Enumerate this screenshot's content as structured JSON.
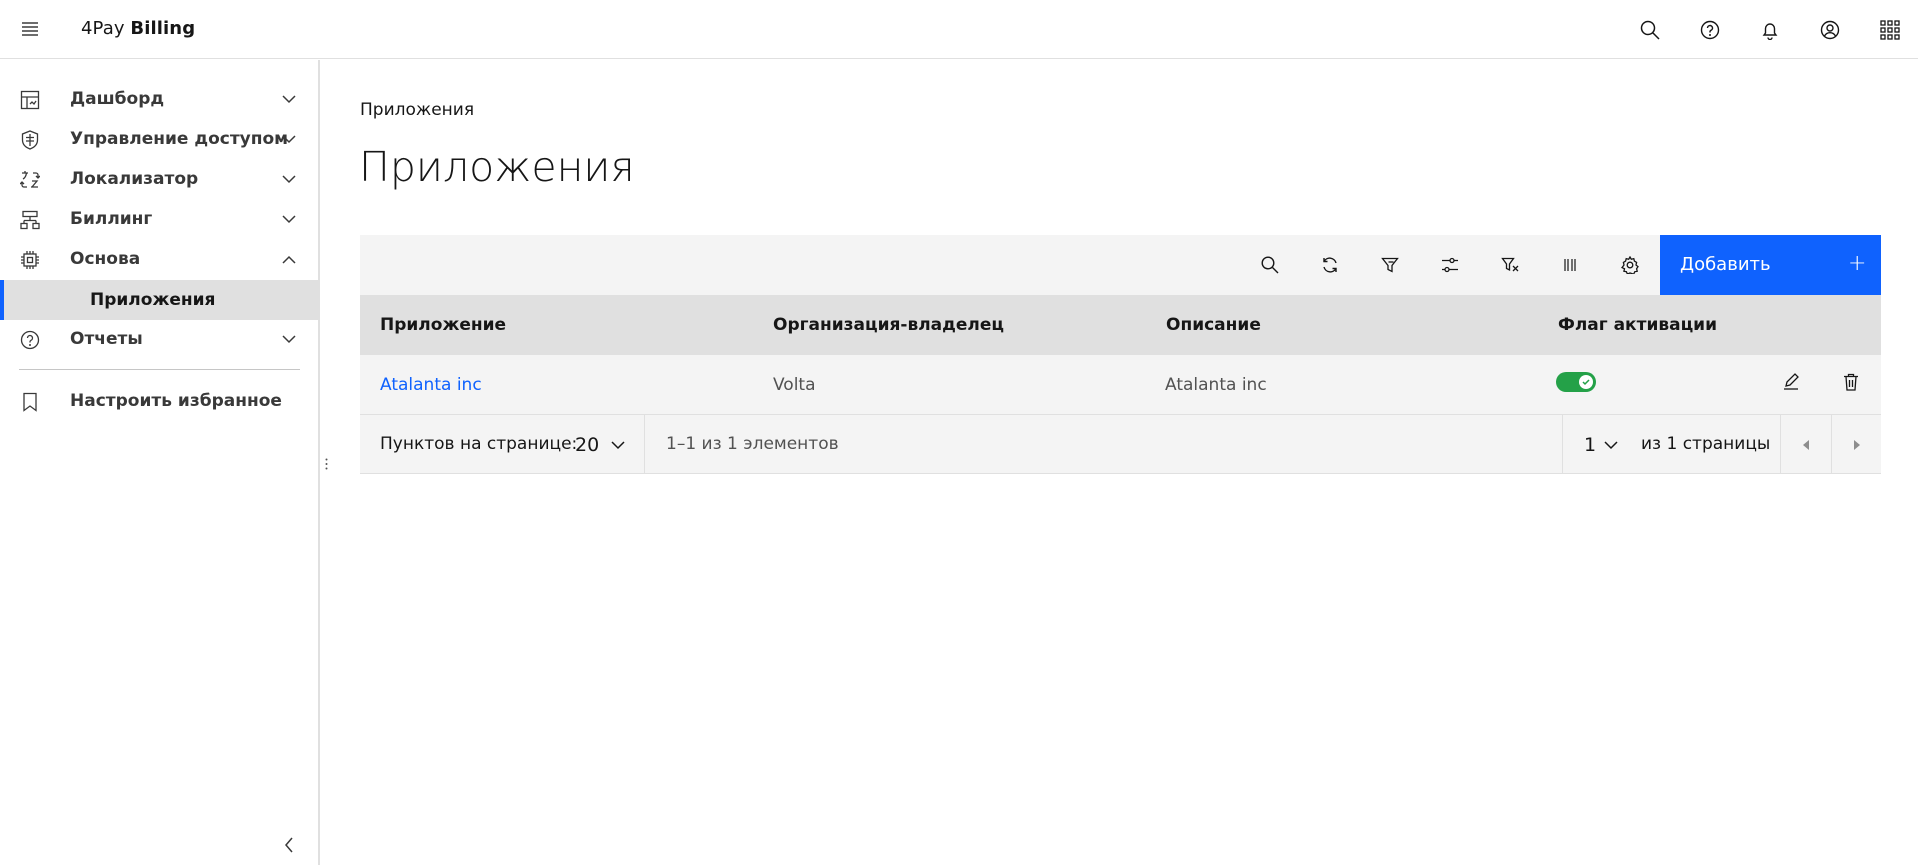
{
  "header": {
    "brand_prefix": "4Pay ",
    "brand_name": "Billing",
    "icons": [
      "menu-icon",
      "search-icon",
      "help-icon",
      "notification-icon",
      "user-icon",
      "app-switcher-icon"
    ]
  },
  "sidebar": {
    "items": [
      {
        "label": "Дашборд",
        "icon": "dashboard-icon",
        "expanded": false
      },
      {
        "label": "Управление доступом",
        "icon": "security-icon",
        "expanded": false
      },
      {
        "label": "Локализатор",
        "icon": "translate-icon",
        "expanded": false
      },
      {
        "label": "Биллинг",
        "icon": "hierarchy-icon",
        "expanded": false
      },
      {
        "label": "Основа",
        "icon": "chip-icon",
        "expanded": true
      },
      {
        "label": "Отчеты",
        "icon": "help-icon",
        "expanded": false
      }
    ],
    "sub_item": {
      "label": "Приложения",
      "active": true
    },
    "favorites": {
      "label": "Настроить избранное",
      "icon": "bookmark-icon"
    }
  },
  "breadcrumb": "Приложения",
  "page_title": "Приложения",
  "toolbar": {
    "icons": [
      "search-icon",
      "refresh-icon",
      "filter-icon",
      "settings-adjust-icon",
      "filter-remove-icon",
      "columns-icon",
      "gear-icon"
    ],
    "add_label": "Добавить",
    "add_symbol": "+"
  },
  "table": {
    "columns": [
      "Приложение",
      "Организация-владелец",
      "Описание",
      "Флаг активации"
    ],
    "rows": [
      {
        "app": "Atalanta inc",
        "owner": "Volta",
        "description": "Atalanta inc",
        "active": true
      }
    ]
  },
  "pagination": {
    "per_page_label": "Пунктов на странице:",
    "per_page": "20",
    "range": "1–1 из 1 элементов",
    "page": "1",
    "of_pages": "из 1 страницы"
  },
  "colors": {
    "accent": "#0f62fe",
    "toggle_on": "#24a148",
    "active_bg": "#e0e0e0"
  }
}
